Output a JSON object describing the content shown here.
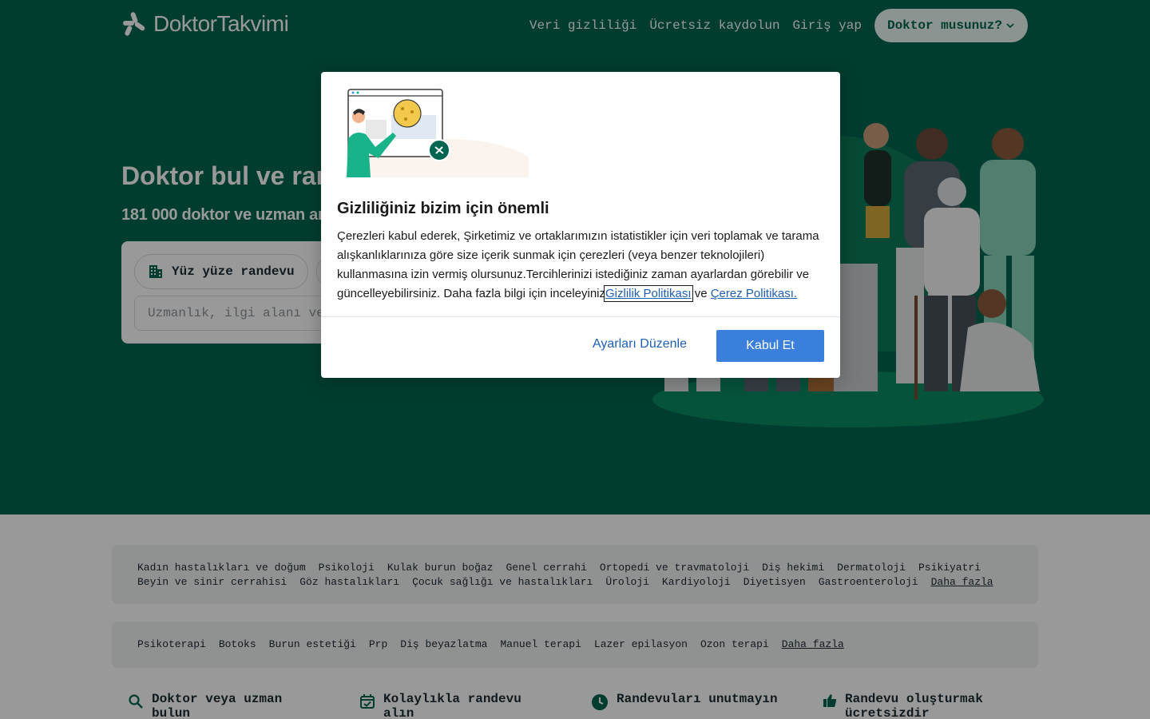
{
  "header": {
    "logo_text": "DoktorTakvimi",
    "nav": [
      {
        "label": "Veri gizliliği"
      },
      {
        "label": "Ücretsiz kaydolun"
      },
      {
        "label": "Giriş yap"
      }
    ],
    "doctor_button": "Doktor musunuz?"
  },
  "hero": {
    "title": "Doktor bul ve randevu al",
    "subtitle": "181 000 doktor ve uzman arasından seçim yapın",
    "mode_label": "Yüz yüze randevu",
    "search_placeholder": "Uzmanlık, ilgi alanı veya doktor adı"
  },
  "specialties": {
    "row1": [
      "Kadın hastalıkları ve doğum",
      "Psikoloji",
      "Kulak burun boğaz",
      "Genel cerrahi",
      "Ortopedi ve travmatoloji",
      "Diş hekimi",
      "Dermatoloji",
      "Psikiyatri"
    ],
    "row2": [
      "Beyin ve sinir cerrahisi",
      "Göz hastalıkları",
      "Çocuk sağlığı ve hastalıkları",
      "Üroloji",
      "Kardiyoloji",
      "Diyetisyen",
      "Gastroenteroloji"
    ],
    "more": "Daha fazla"
  },
  "treatments": {
    "items": [
      "Psikoterapi",
      "Botoks",
      "Burun estetiği",
      "Prp",
      "Diş beyazlatma",
      "Manuel terapi",
      "Lazer epilasyon",
      "Ozon terapi"
    ],
    "more": "Daha fazla"
  },
  "features": [
    {
      "text": "Doktor veya uzman bulun",
      "icon": "search-icon"
    },
    {
      "text": "Kolaylıkla randevu alın",
      "icon": "calendar-check-icon"
    },
    {
      "text": "Randevuları unutmayın",
      "icon": "clock-icon"
    },
    {
      "text": "Randevu oluşturmak ücretsizdir",
      "icon": "thumbs-up-icon"
    }
  ],
  "cookie_modal": {
    "title": "Gizliliğiniz bizim için önemli",
    "body": "Çerezleri kabul ederek, Şirketimiz ve ortaklarımızın istatistikler için veri toplamak ve tarama alışkanlıklarınıza göre size içerik sunmak için çerezleri (veya benzer teknolojileri) kullanmasına izin vermiş olursunuz.Tercihlerinizi istediğiniz zaman ayarlardan görebilir ve güncelleyebilirsiniz. Daha fazla bilgi için inceleyiniz",
    "privacy_link": "Gizlilik Politikası",
    "and_word": "ve",
    "cookie_link": "Çerez Politikası.",
    "settings_button": "Ayarları Düzenle",
    "accept_button": "Kabul Et"
  },
  "colors": {
    "brand_green": "#00664f",
    "accept_blue": "#3a7fdb",
    "link_blue": "#1e5fb4"
  }
}
